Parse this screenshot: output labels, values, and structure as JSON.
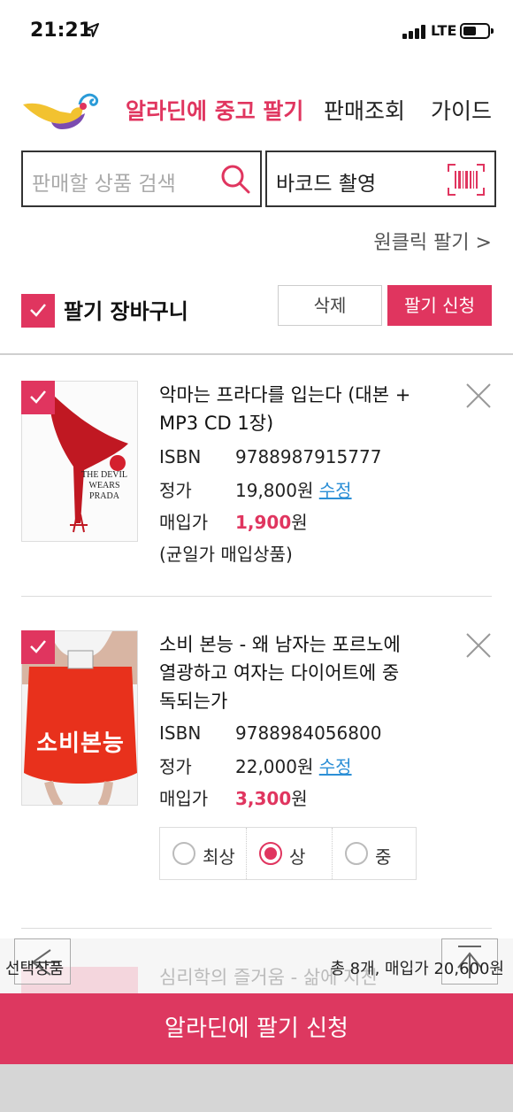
{
  "status": {
    "time": "21:21",
    "network": "LTE"
  },
  "nav": {
    "title": "알라딘에 중고 팔기",
    "links": [
      "판매조회",
      "가이드"
    ]
  },
  "search": {
    "placeholder": "판매할 상품 검색",
    "barcode_label": "바코드 촬영"
  },
  "oneclick": "원클릭 팔기 >",
  "cart": {
    "title": "팔기 장바구니",
    "delete_label": "삭제",
    "apply_label": "팔기 신청"
  },
  "items": [
    {
      "title": "악마는 프라다를 입는다 (대본 + MP3 CD 1장)",
      "isbn_label": "ISBN",
      "isbn": "9788987915777",
      "price_label": "정가",
      "price": "19,800원",
      "edit_label": "수정",
      "buy_label": "매입가",
      "buy_price": "1,900",
      "won": "원",
      "note": "(균일가 매입상품)",
      "cover_text": "THE DEVIL WEARS PRADA"
    },
    {
      "title": "소비 본능 - 왜 남자는 포르노에 열광하고 여자는 다이어트에 중독되는가",
      "isbn_label": "ISBN",
      "isbn": "9788984056800",
      "price_label": "정가",
      "price": "22,000원",
      "edit_label": "수정",
      "buy_label": "매입가",
      "buy_price": "3,300",
      "won": "원",
      "cover_text": "소비본능",
      "grades": [
        "최상",
        "상",
        "중"
      ],
      "selected_grade": "상"
    }
  ],
  "peek": {
    "next_title": "심리학의 즐거움 - 삶에 지친",
    "selected_label": "선택상품",
    "total": "총 8개, 매입가 20,600원"
  },
  "bottom_button": "알라딘에 팔기 신청",
  "colors": {
    "accent": "#e0355f",
    "link": "#2c8fd6"
  }
}
